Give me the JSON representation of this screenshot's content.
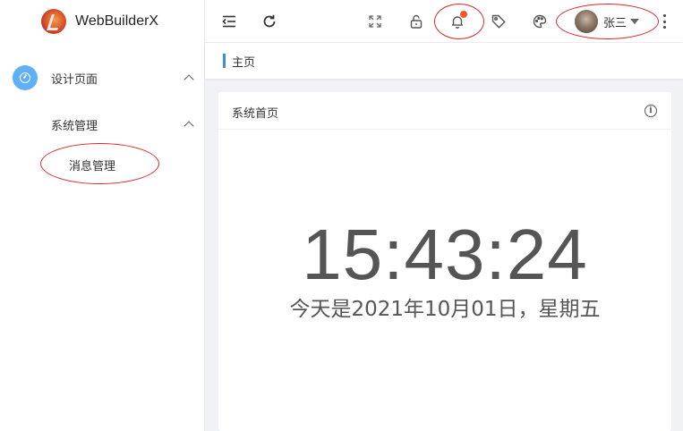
{
  "brand": {
    "name": "WebBuilderX"
  },
  "sidebar": {
    "items": [
      {
        "label": "设计页面"
      },
      {
        "label": "系统管理"
      },
      {
        "label": "消息管理"
      }
    ]
  },
  "header": {
    "user_name": "张三",
    "icons": [
      "menu-fold-icon",
      "refresh-icon",
      "fullscreen-icon",
      "lock-icon",
      "bell-icon",
      "tag-icon",
      "palette-icon",
      "more-vertical-icon"
    ],
    "notification_dot_color": "#f2562a",
    "annotation_color": "#d82a2a"
  },
  "breadcrumb": {
    "current": "主页",
    "accent": "#3d8de0"
  },
  "card": {
    "title": "系统首页",
    "time": "15:43:24",
    "date": "今天是2021年10月01日，星期五"
  }
}
